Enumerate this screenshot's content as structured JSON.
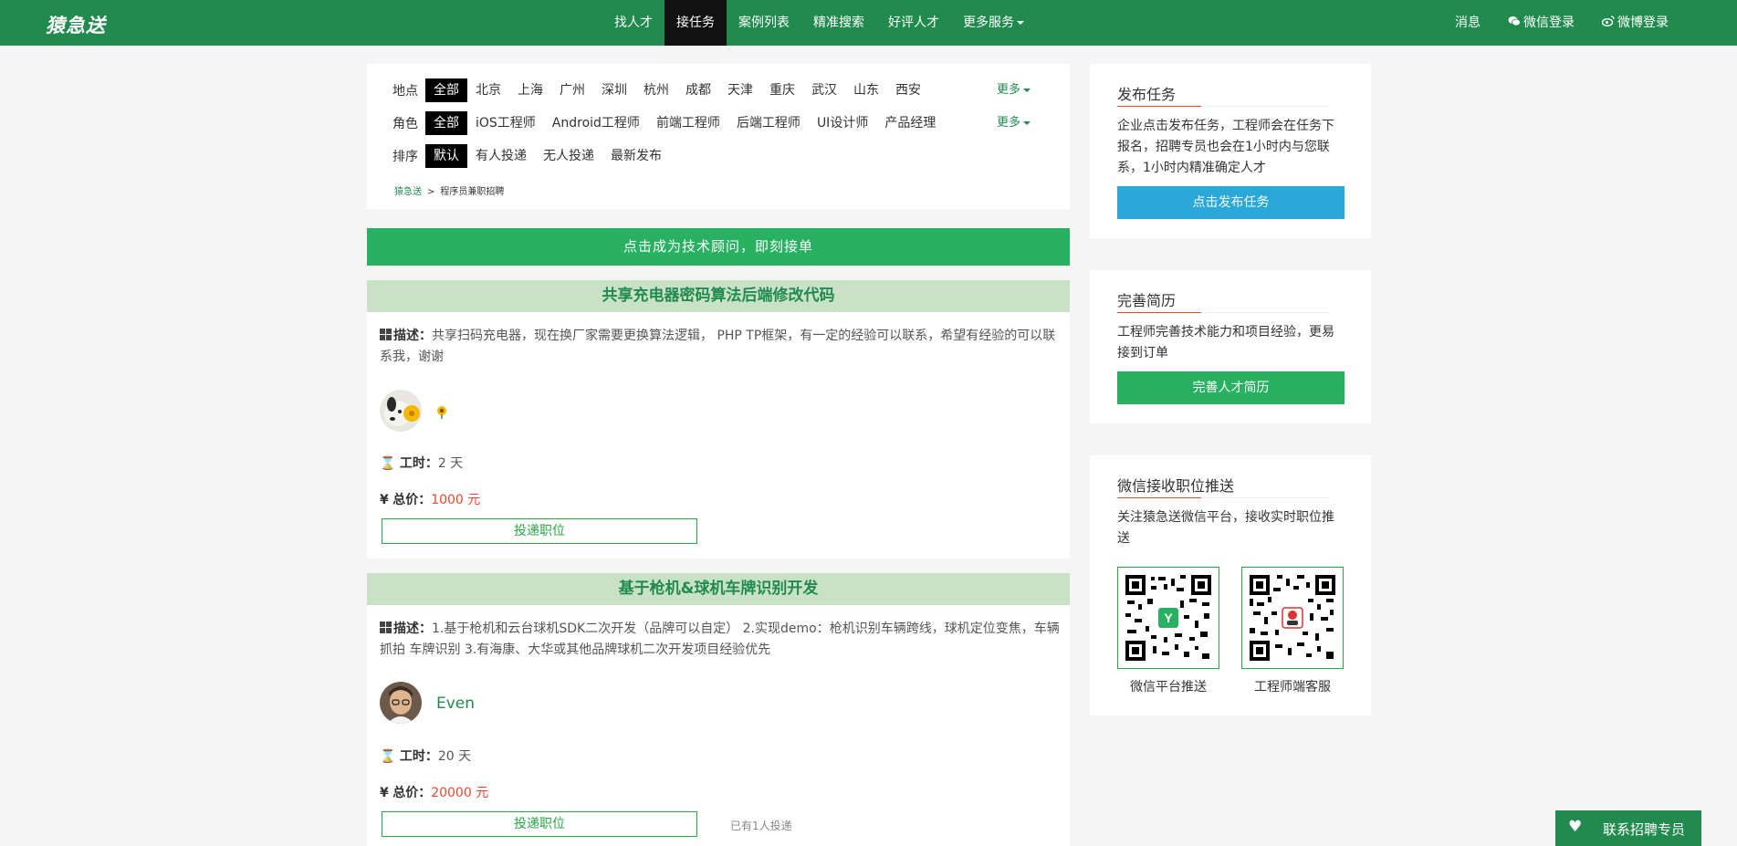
{
  "brand": {
    "logo": "猿急送"
  },
  "nav": {
    "items": [
      {
        "label": "找人才",
        "active": false
      },
      {
        "label": "接任务",
        "active": true
      },
      {
        "label": "案例列表",
        "active": false
      },
      {
        "label": "精准搜索",
        "active": false
      },
      {
        "label": "好评人才",
        "active": false
      },
      {
        "label": "更多服务",
        "active": false,
        "dropdown": true
      }
    ],
    "right": [
      {
        "label": "消息",
        "icon": ""
      },
      {
        "label": "微信登录",
        "icon": "wechat-icon"
      },
      {
        "label": "微博登录",
        "icon": "weibo-icon"
      }
    ]
  },
  "filters": {
    "location": {
      "label": "地点",
      "options": [
        "全部",
        "北京",
        "上海",
        "广州",
        "深圳",
        "杭州",
        "成都",
        "天津",
        "重庆",
        "武汉",
        "山东",
        "西安"
      ],
      "selected": 0,
      "more": "更多"
    },
    "role": {
      "label": "角色",
      "options": [
        "全部",
        "iOS工程师",
        "Android工程师",
        "前端工程师",
        "后端工程师",
        "UI设计师",
        "产品经理"
      ],
      "selected": 0,
      "more": "更多"
    },
    "sort": {
      "label": "排序",
      "options": [
        "默认",
        "有人投递",
        "无人投递",
        "最新发布"
      ],
      "selected": 0
    }
  },
  "breadcrumb": {
    "home": "猿急送",
    "separator": ">",
    "current": "程序员兼职招聘"
  },
  "cta_banner": "点击成为技术顾问，即刻接单",
  "jobs": [
    {
      "title": "共享充电器密码算法后端修改代码",
      "desc_label": "描述：",
      "description": "共享扫码充电器，现在换厂家需要更换算法逻辑， PHP TP框架，有一定的经验可以联系，希望有经验的可以联系我，谢谢",
      "username": "",
      "duration_label": "工时：",
      "duration": "2 天",
      "price_label": "总价：",
      "price": "1000 元",
      "apply_label": "投递职位",
      "applied_note": ""
    },
    {
      "title": "基于枪机&球机车牌识别开发",
      "desc_label": "描述：",
      "description": "1.基于枪机和云台球机SDK二次开发（品牌可以自定） 2.实现demo：枪机识别车辆跨线，球机定位变焦，车辆抓拍 车牌识别 3.有海康、大华或其他品牌球机二次开发项目经验优先",
      "username": "Even",
      "duration_label": "工时：",
      "duration": "20 天",
      "price_label": "总价：",
      "price": "20000 元",
      "apply_label": "投递职位",
      "applied_note": "已有1人投递"
    }
  ],
  "sidebar": {
    "publish": {
      "title": "发布任务",
      "text": "企业点击发布任务，工程师会在任务下报名，招聘专员也会在1小时内与您联系，1小时内精准确定人才",
      "button": "点击发布任务",
      "button_color": "#2aa8d8"
    },
    "resume": {
      "title": "完善简历",
      "text": "工程师完善技术能力和项目经验，更易接到订单",
      "button": "完善人才简历",
      "button_color": "#28b160"
    },
    "wechat": {
      "title": "微信接收职位推送",
      "text": "关注猿急送微信平台，接收实时职位推送",
      "qr": [
        {
          "caption": "微信平台推送"
        },
        {
          "caption": "工程师端客服"
        }
      ]
    }
  },
  "contact_button": "联系招聘专员",
  "colors": {
    "brand_green": "#218b4e",
    "accent_green": "#28b160",
    "price_red": "#e8482f",
    "publish_blue": "#2aa8d8"
  }
}
